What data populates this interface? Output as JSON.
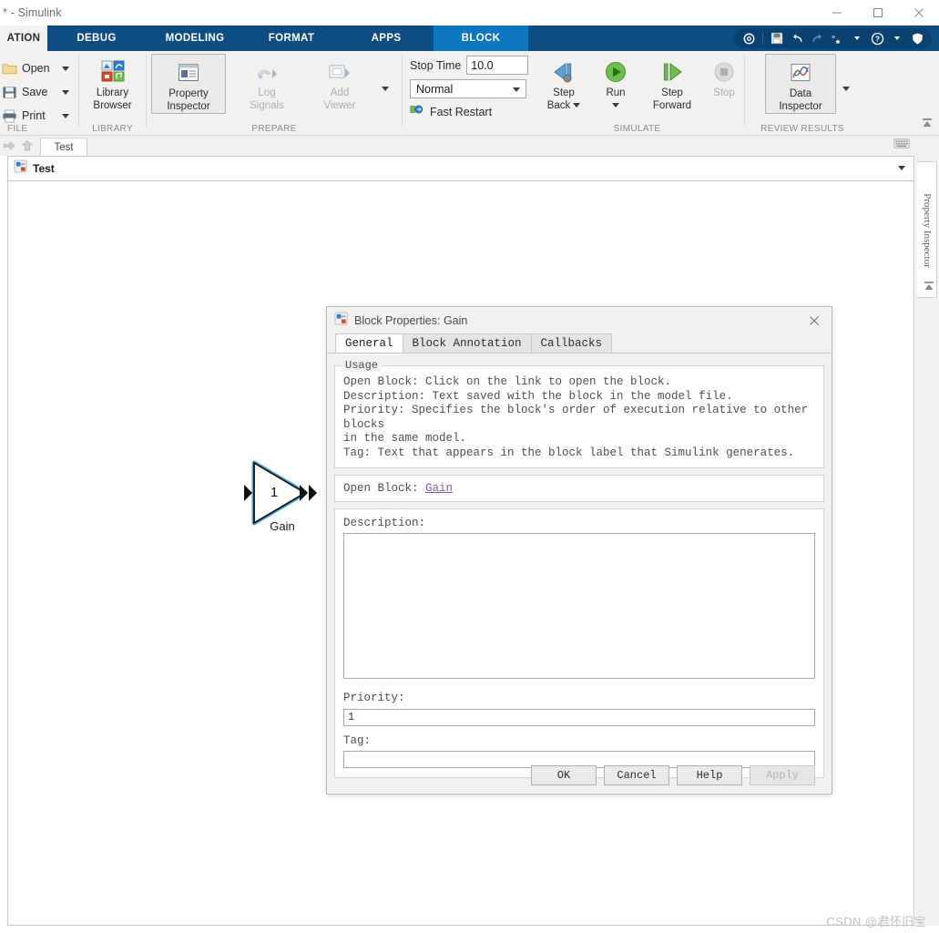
{
  "window": {
    "title": "t * - Simulink",
    "minimize_label": "Minimize",
    "maximize_label": "Maximize",
    "close_label": "Close"
  },
  "ribbon": {
    "tabs": [
      {
        "label": "ATION",
        "active": false,
        "first": true
      },
      {
        "label": "DEBUG",
        "active": false
      },
      {
        "label": "MODELING",
        "active": false
      },
      {
        "label": "FORMAT",
        "active": false
      },
      {
        "label": "APPS",
        "active": false
      },
      {
        "label": "BLOCK",
        "active": true
      }
    ],
    "quick_access": {
      "gear": "gear-icon",
      "save": "save-icon",
      "undo": "undo-icon",
      "redo": "redo-icon",
      "favorites": "favorites-icon",
      "help": "help-icon",
      "shield": "shield-icon"
    },
    "groups": {
      "file": {
        "label": "FILE",
        "items": [
          {
            "label": "Open",
            "icon": "folder-icon"
          },
          {
            "label": "Save",
            "icon": "floppy-icon"
          },
          {
            "label": "Print",
            "icon": "printer-icon"
          }
        ]
      },
      "library": {
        "label": "LIBRARY",
        "button": {
          "line1": "Library",
          "line2": "Browser",
          "icon": "library-browser-icon"
        }
      },
      "prepare": {
        "label": "PREPARE",
        "buttons": [
          {
            "line1": "Property",
            "line2": "Inspector",
            "icon": "property-inspector-icon",
            "enabled": true,
            "selected": true
          },
          {
            "line1": "Log",
            "line2": "Signals",
            "icon": "log-signals-icon",
            "enabled": false
          },
          {
            "line1": "Add",
            "line2": "Viewer",
            "icon": "add-viewer-icon",
            "enabled": false
          }
        ]
      },
      "simulate": {
        "label": "SIMULATE",
        "stop_time_label": "Stop Time",
        "stop_time_value": "10.0",
        "mode_value": "Normal",
        "fast_restart_label": "Fast Restart",
        "buttons": [
          {
            "line1": "Step",
            "line2": "Back",
            "icon": "step-back-icon",
            "enabled": true,
            "caret": true
          },
          {
            "line1": "Run",
            "line2": "",
            "icon": "run-icon",
            "enabled": true,
            "caret": true
          },
          {
            "line1": "Step",
            "line2": "Forward",
            "icon": "step-forward-icon",
            "enabled": true,
            "caret": false
          },
          {
            "line1": "Stop",
            "line2": "",
            "icon": "stop-icon",
            "enabled": false,
            "caret": false
          }
        ]
      },
      "review": {
        "label": "REVIEW RESULTS",
        "button": {
          "line1": "Data",
          "line2": "Inspector",
          "icon": "data-inspector-icon"
        }
      }
    }
  },
  "model": {
    "tab_label": "Test",
    "breadcrumb_label": "Test",
    "block": {
      "value": "1",
      "label": "Gain"
    }
  },
  "property_inspector_panel": {
    "label": "Property Inspector"
  },
  "dialog": {
    "title": "Block Properties: Gain",
    "tabs": [
      {
        "label": "General",
        "active": true
      },
      {
        "label": "Block Annotation",
        "active": false
      },
      {
        "label": "Callbacks",
        "active": false
      }
    ],
    "usage": {
      "legend": "Usage",
      "lines": [
        "Open Block: Click on the link to open the block.",
        "Description: Text saved with the block in the model file.",
        "Priority: Specifies the block's order of execution relative to other blocks",
        "in the same model.",
        "Tag: Text that appears in the block label that Simulink generates."
      ]
    },
    "open_block": {
      "label": "Open Block:",
      "link": "Gain"
    },
    "description": {
      "label": "Description:",
      "value": "",
      "placeholder": ""
    },
    "priority": {
      "label": "Priority:",
      "value": "1"
    },
    "tag": {
      "label": "Tag:",
      "value": "",
      "placeholder": ""
    },
    "buttons": [
      {
        "label": "OK",
        "enabled": true
      },
      {
        "label": "Cancel",
        "enabled": true
      },
      {
        "label": "Help",
        "enabled": true
      },
      {
        "label": "Apply",
        "enabled": false
      }
    ]
  },
  "watermark": {
    "text": "CSDN @君怀旧宝"
  },
  "colors": {
    "ribbon_navy": "#0e4c84",
    "ribbon_active_blue": "#0c76c1",
    "chrome_gray": "#f2f1f0",
    "link_purple": "#7a5bb5",
    "selection_blue": "#4fa8e0",
    "run_green": "#3f9b35"
  }
}
